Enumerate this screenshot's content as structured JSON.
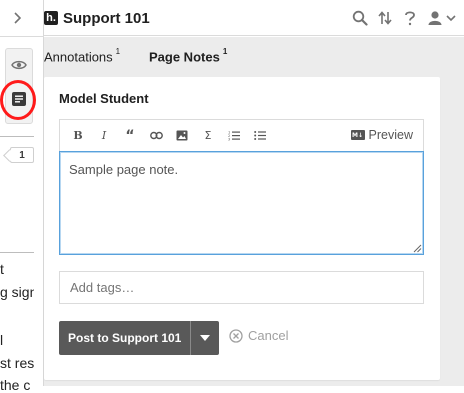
{
  "host": {
    "annotation_count": "1",
    "text_lines": [
      "t",
      "g signa",
      "",
      "l",
      "st resp",
      "the c"
    ]
  },
  "topbar": {
    "logo_letter": "h.",
    "group_name": "Support 101",
    "icons": [
      "search-icon",
      "sort-icon",
      "help-icon",
      "user-icon",
      "chevron-down-icon"
    ]
  },
  "tabs": {
    "annotations_label": "Annotations",
    "annotations_count": "1",
    "page_notes_label": "Page Notes",
    "page_notes_count": "1"
  },
  "card": {
    "author": "Model Student",
    "toolbar_buttons": [
      "B",
      "I",
      "“",
      "link-icon",
      "image-icon",
      "Σ",
      "numbered-list-icon",
      "bulleted-list-icon"
    ],
    "preview_label": "Preview",
    "md_mark": "M↓",
    "note_text": "Sample page note.",
    "tags_placeholder": "Add tags…",
    "post_label": "Post to Support 101",
    "cancel_label": "Cancel"
  },
  "colors": {
    "highlight_ring": "#ff1a1a",
    "focus_border": "#58a1dc",
    "post_button": "#595959",
    "sidebar_bg": "#ececec"
  }
}
